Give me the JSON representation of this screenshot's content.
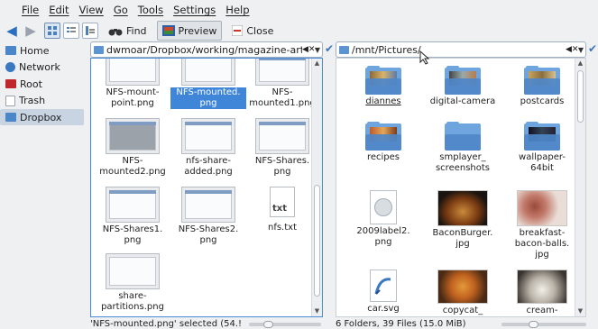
{
  "menubar": {
    "items": [
      {
        "label": "File"
      },
      {
        "label": "Edit"
      },
      {
        "label": "View"
      },
      {
        "label": "Go"
      },
      {
        "label": "Tools"
      },
      {
        "label": "Settings"
      },
      {
        "label": "Help"
      }
    ]
  },
  "toolbar": {
    "find_label": "Find",
    "preview_label": "Preview",
    "close_label": "Close"
  },
  "places": {
    "items": [
      {
        "label": "Home",
        "icon": "home-folder-icon",
        "color": "#4a86c8"
      },
      {
        "label": "Network",
        "icon": "network-globe-icon",
        "color": "#3a78c2"
      },
      {
        "label": "Root",
        "icon": "root-folder-icon",
        "color": "#c0272d"
      },
      {
        "label": "Trash",
        "icon": "trash-icon",
        "color": "#9aa3ad"
      },
      {
        "label": "Dropbox",
        "icon": "dropbox-folder-icon",
        "color": "#4a86c8"
      }
    ],
    "active": "Dropbox"
  },
  "left": {
    "location": "dwmoar/Dropbox/working/magazine-articles/",
    "files": [
      {
        "name": "NFS-mount-point.png",
        "line1": "NFS-mount-",
        "line2": "point.png"
      },
      {
        "name": "NFS-mounted.png",
        "line1": "NFS-mounted.",
        "line2": "png",
        "selected": true
      },
      {
        "name": "NFS-mounted1.png",
        "line1": "NFS-",
        "line2": "mounted1.png"
      },
      {
        "name": "NFS-mounted2.png",
        "line1": "NFS-",
        "line2": "mounted2.png"
      },
      {
        "name": "nfs-share-added.png",
        "line1": "nfs-share-",
        "line2": "added.png"
      },
      {
        "name": "NFS-Shares.png",
        "line1": "NFS-Shares.",
        "line2": "png"
      },
      {
        "name": "NFS-Shares1.png",
        "line1": "NFS-Shares1.",
        "line2": "png"
      },
      {
        "name": "NFS-Shares2.png",
        "line1": "NFS-Shares2.",
        "line2": "png"
      },
      {
        "name": "nfs.txt",
        "line1": "nfs.txt",
        "line2": "",
        "icon_label": "txt"
      },
      {
        "name": "share-partitions.png",
        "line1": "share-",
        "line2": "partitions.png"
      }
    ],
    "status": "'NFS-mounted.png' selected (54.!"
  },
  "right": {
    "location": "/mnt/Pictures/",
    "items": [
      {
        "name": "diannes",
        "line1": "diannes",
        "line2": "",
        "kind": "folder"
      },
      {
        "name": "digital-camera",
        "line1": "digital-camera",
        "line2": "",
        "kind": "folder"
      },
      {
        "name": "postcards",
        "line1": "postcards",
        "line2": "",
        "kind": "folder"
      },
      {
        "name": "recipes",
        "line1": "recipes",
        "line2": "",
        "kind": "folder"
      },
      {
        "name": "smplayer_screenshots",
        "line1": "smplayer_",
        "line2": "screenshots",
        "kind": "folder"
      },
      {
        "name": "wallpaper-64bit",
        "line1": "wallpaper-",
        "line2": "64bit",
        "kind": "folder"
      },
      {
        "name": "2009label2.png",
        "line1": "2009label2.",
        "line2": "png",
        "kind": "image"
      },
      {
        "name": "BaconBurger.jpg",
        "line1": "BaconBurger.",
        "line2": "jpg",
        "kind": "photo"
      },
      {
        "name": "breakfast-bacon-balls.jpg",
        "line1": "breakfast-",
        "line2": "bacon-balls.",
        "line3": "jpg",
        "kind": "photo"
      },
      {
        "name": "car.svg",
        "line1": "car.svg",
        "line2": "",
        "kind": "svg"
      },
      {
        "name": "copycat_",
        "line1": "copycat_",
        "line2": "",
        "kind": "photo"
      },
      {
        "name": "cream-",
        "line1": "cream-",
        "line2": "",
        "kind": "photo"
      }
    ],
    "status": "6 Folders, 39 Files (15.0 MiB)"
  },
  "colors": {
    "accent": "#3f86d9",
    "folder": "#5b93d3"
  }
}
